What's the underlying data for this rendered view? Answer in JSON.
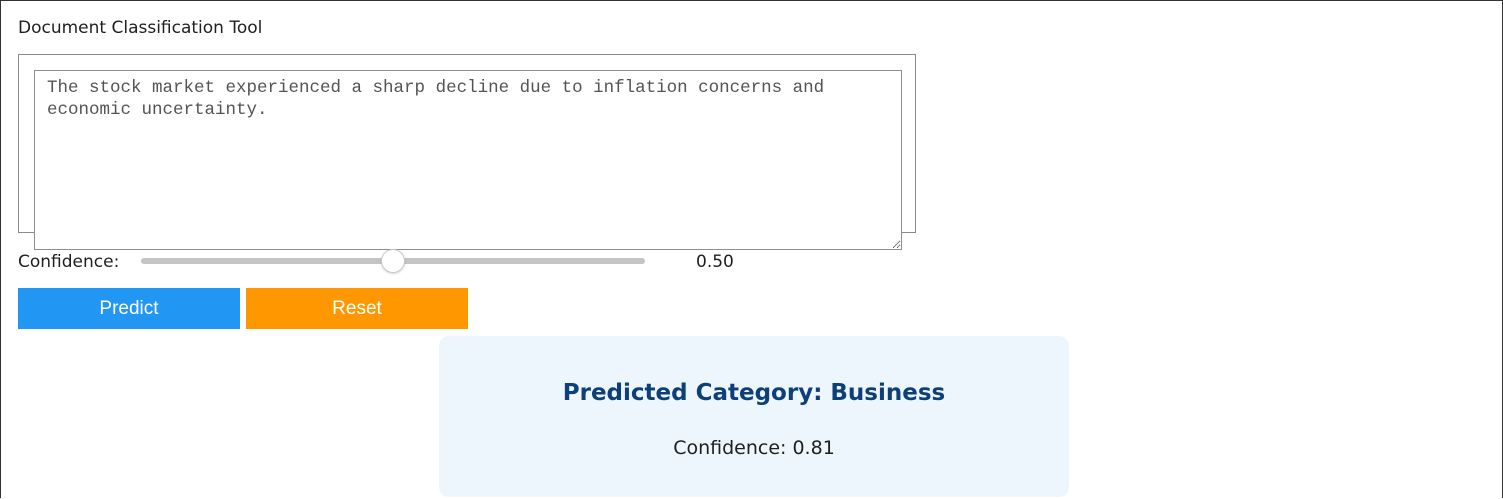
{
  "app": {
    "title": "Document Classification Tool"
  },
  "input": {
    "text": "The stock market experienced a sharp decline due to inflation concerns and economic uncertainty."
  },
  "confidence": {
    "label": "Confidence:",
    "value": 0.5,
    "value_text": "0.50",
    "min": 0,
    "max": 1
  },
  "buttons": {
    "predict_label": "Predict",
    "reset_label": "Reset"
  },
  "result": {
    "category_text": "Predicted Category: Business",
    "confidence_text": "Confidence: 0.81"
  },
  "colors": {
    "predict": "#2196f3",
    "reset": "#ff9800",
    "result_bg": "#eef6fd",
    "result_title": "#0d3f7a"
  }
}
